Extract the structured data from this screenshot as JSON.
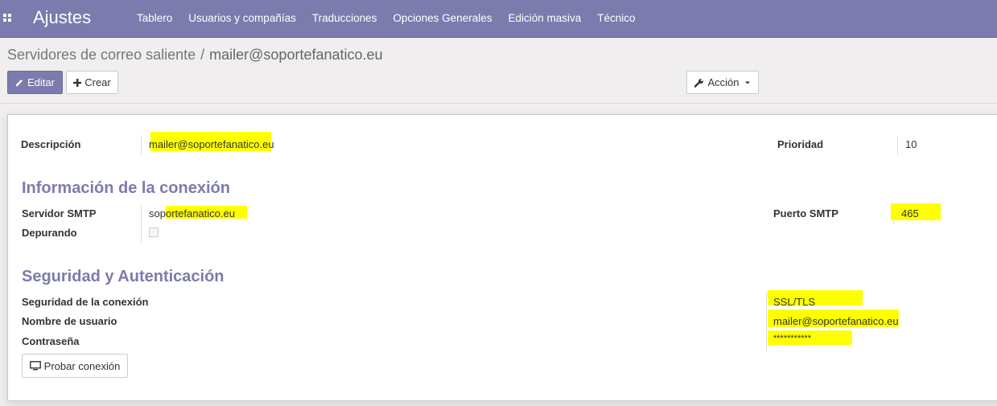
{
  "navbar": {
    "app_title": "Ajustes",
    "menu": [
      {
        "label": "Tablero"
      },
      {
        "label": "Usuarios y compañías"
      },
      {
        "label": "Traducciones"
      },
      {
        "label": "Opciones Generales"
      },
      {
        "label": "Edición masiva"
      },
      {
        "label": "Técnico"
      }
    ]
  },
  "breadcrumb": {
    "parent": "Servidores de correo saliente",
    "separator": "/",
    "current": "mailer@soportefanatico.eu"
  },
  "buttons": {
    "edit": "Editar",
    "create": "Crear",
    "action": "Acción",
    "test_connection": "Probar conexión"
  },
  "form": {
    "description_label": "Descripción",
    "description_value": "mailer@soportefanatico.eu",
    "priority_label": "Prioridad",
    "priority_value": "10",
    "connection_section": "Información de la conexión",
    "smtp_server_label": "Servidor SMTP",
    "smtp_server_value": "soportefanatico.eu",
    "smtp_port_label": "Puerto SMTP",
    "smtp_port_value": "465",
    "debug_label": "Depurando",
    "debug_checked": false,
    "security_section": "Seguridad y Autenticación",
    "connection_security_label": "Seguridad de la conexión",
    "connection_security_value": "SSL/TLS",
    "username_label": "Nombre de usuario",
    "username_value": "mailer@soportefanatico.eu",
    "password_label": "Contraseña",
    "password_value": "***********"
  },
  "colors": {
    "brand": "#7c7bad",
    "highlight": "#ffff00"
  },
  "icons": {
    "apps": "apps-grid-icon",
    "edit": "pencil-icon",
    "create": "plus-icon",
    "action": "wrench-icon",
    "dropdown": "caret-down-icon",
    "test": "monitor-icon"
  }
}
